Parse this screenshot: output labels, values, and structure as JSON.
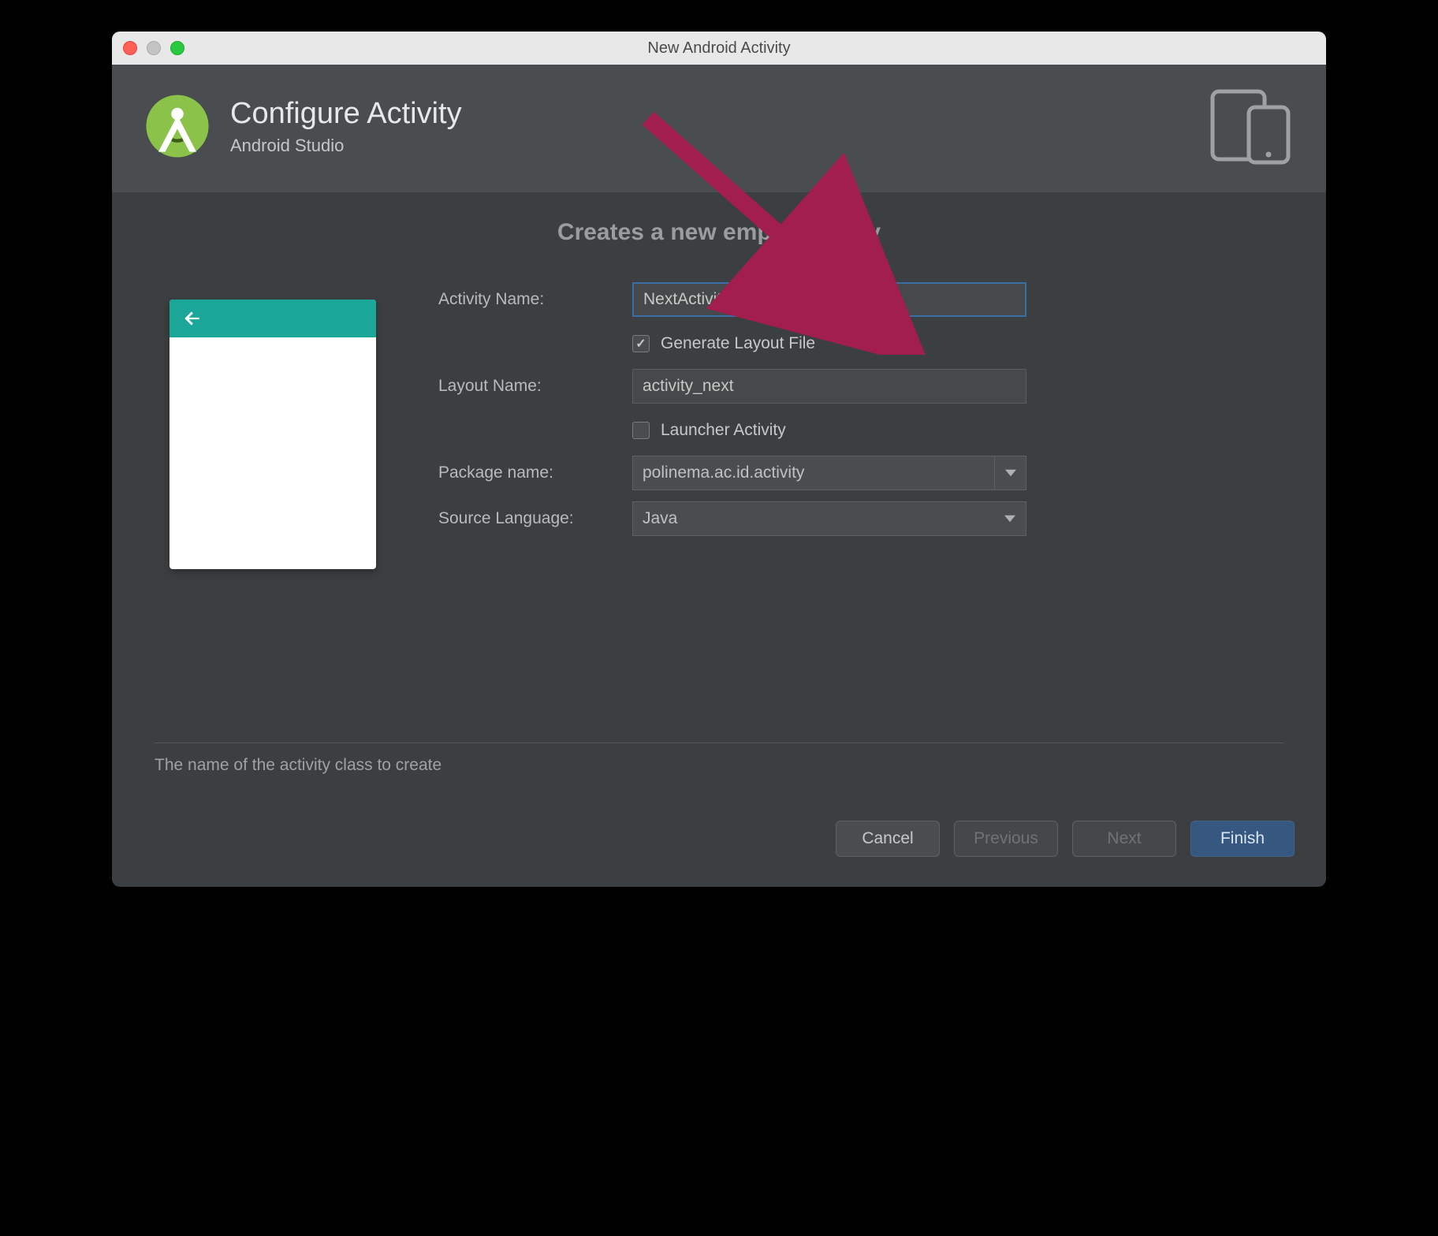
{
  "window": {
    "title": "New Android Activity"
  },
  "header": {
    "title": "Configure Activity",
    "subtitle": "Android Studio"
  },
  "main": {
    "heading": "Creates a new empty activity",
    "labels": {
      "activity_name": "Activity Name:",
      "layout_name": "Layout Name:",
      "package_name": "Package name:",
      "source_language": "Source Language:"
    },
    "fields": {
      "activity_name": "NextActivity",
      "layout_name": "activity_next",
      "package_name": "polinema.ac.id.activity",
      "source_language": "Java"
    },
    "checkboxes": {
      "generate_layout": {
        "label": "Generate Layout File",
        "checked": true
      },
      "launcher_activity": {
        "label": "Launcher Activity",
        "checked": false
      }
    },
    "hint": "The name of the activity class to create"
  },
  "footer": {
    "cancel": "Cancel",
    "previous": "Previous",
    "next": "Next",
    "finish": "Finish"
  }
}
